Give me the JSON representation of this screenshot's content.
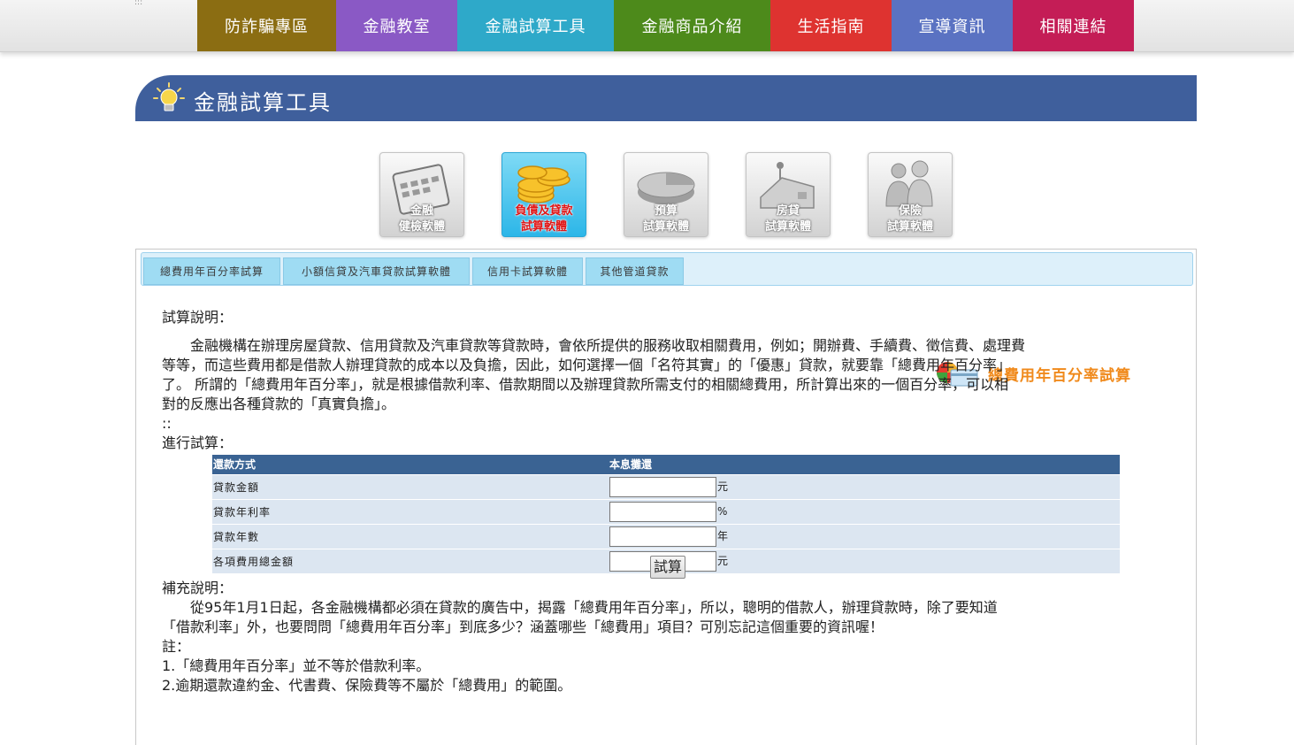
{
  "top_dots": ":::",
  "nav": [
    {
      "label": "防詐騙專區",
      "color": "#8b6d12",
      "width": 157
    },
    {
      "label": "金融教室",
      "color": "#8a59c5",
      "width": 137
    },
    {
      "label": "金融試算工具",
      "color": "#2ea9c9",
      "width": 177
    },
    {
      "label": "金融商品介紹",
      "color": "#4d8a1b",
      "width": 177
    },
    {
      "label": "生活指南",
      "color": "#de3330",
      "width": 137
    },
    {
      "label": "宣導資訊",
      "color": "#5a72c2",
      "width": 137
    },
    {
      "label": "相關連結",
      "color": "#c41d56",
      "width": 137
    }
  ],
  "section": {
    "title": "金融試算工具"
  },
  "categories": [
    {
      "line1": "金融",
      "line2": "健檢軟體",
      "active": false,
      "icon": "calendar-icon"
    },
    {
      "line1": "負債及貸款",
      "line2": "試算軟體",
      "active": true,
      "icon": "coins-icon"
    },
    {
      "line1": "預算",
      "line2": "試算軟體",
      "active": false,
      "icon": "pie-icon"
    },
    {
      "line1": "房貸",
      "line2": "試算軟體",
      "active": false,
      "icon": "house-icon"
    },
    {
      "line1": "保險",
      "line2": "試算軟體",
      "active": false,
      "icon": "people-icon"
    }
  ],
  "tabs": [
    {
      "label": "總費用年百分率試算"
    },
    {
      "label": "小額信貸及汽車貸款試算軟體"
    },
    {
      "label": "信用卡試算軟體"
    },
    {
      "label": "其他管道貸款"
    }
  ],
  "calc_title": "總費用年百分率試算",
  "desc": {
    "heading": "試算說明：",
    "line1": "　　金融機構在辦理房屋貸款、信用貸款及汽車貸款等貸款時，會依所提供的服務收取相關費用，例如；開辦費、手續費、徵信費、處理費",
    "line2": "等等，而這些費用都是借款人辦理貸款的成本以及負擔，因此，如何選擇一個「名符其實」的「優惠」貸款，就要靠「總費用年百分率」",
    "line3": "了。 所謂的「總費用年百分率」，就是根據借款利率、借款期間以及辦理貸款所需支付的相關總費用，所計算出來的一個百分率，可以相",
    "line4": "對的反應出各種貸款的「真實負擔」。",
    "colons": "::"
  },
  "calc": {
    "heading": "進行試算：",
    "header_label": "還款方式",
    "header_value": "本息攤還",
    "rows": [
      {
        "label": "貸款金額",
        "unit": "元",
        "value": ""
      },
      {
        "label": "貸款年利率",
        "unit": "%",
        "value": ""
      },
      {
        "label": "貸款年數",
        "unit": "年",
        "value": ""
      },
      {
        "label": "各項費用總金額",
        "unit": "元",
        "value": ""
      }
    ],
    "submit": "試算"
  },
  "supplement": {
    "heading": "補充說明：",
    "line1": "　　從95年1月1日起，各金融機構都必須在貸款的廣告中，揭露「總費用年百分率」，所以，聰明的借款人，辦理貸款時，除了要知道",
    "line2": "「借款利率」外，也要問問「總費用年百分率」到底多少？涵蓋哪些「總費用」項目？可別忘記這個重要的資訊喔！",
    "note_heading": "註：",
    "note1": "1.「總費用年百分率」並不等於借款利率。",
    "note2": "2.逾期還款違約金、代書費、保險費等不屬於「總費用」的範圍。"
  }
}
